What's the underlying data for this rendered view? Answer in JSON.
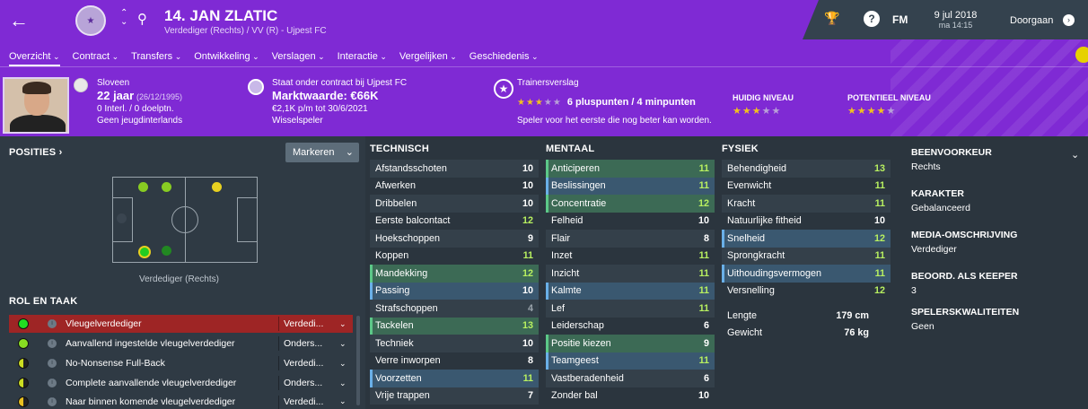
{
  "header": {
    "player_title": "14. JAN ZLATIC",
    "player_subtitle": "Verdediger (Rechts) / VV (R) - Ujpest FC",
    "fm_label": "FM",
    "date": "9 jul 2018",
    "time": "ma 14:15",
    "continue_label": "Doorgaan",
    "help_label": "?"
  },
  "nav": {
    "items": [
      {
        "label": "Overzicht"
      },
      {
        "label": "Contract"
      },
      {
        "label": "Transfers"
      },
      {
        "label": "Ontwikkeling"
      },
      {
        "label": "Verslagen"
      },
      {
        "label": "Interactie"
      },
      {
        "label": "Vergelijken"
      },
      {
        "label": "Geschiedenis"
      }
    ]
  },
  "profile": {
    "nationality": "Sloveen",
    "age": "22 jaar",
    "dob": "(26/12/1995)",
    "caps": "0 Interl. / 0 doelptn.",
    "youth": "Geen jeugdinterlands",
    "contract_text": "Staat onder contract bij Ujpest FC",
    "market_value": "Marktwaarde: €66K",
    "wage": "€2,1K p/m tot 30/6/2021",
    "squad_status": "Wisselspeler"
  },
  "trainer_report": {
    "title": "Trainersverslag",
    "stars_on": 3,
    "points": "6 pluspunten / 4 minpunten",
    "note": "Speler voor het eerste die nog beter kan worden.",
    "current_label": "HUIDIG NIVEAU",
    "current_stars": 3,
    "potential_label": "POTENTIEEL NIVEAU",
    "potential_stars": 4
  },
  "positions": {
    "title": "POSITIES ›",
    "mark_button": "Markeren",
    "position_label": "Verdediger (Rechts)"
  },
  "roles": {
    "title": "ROL EN TAAK",
    "items": [
      {
        "name": "Vleugelverdediger",
        "duty": "Verdedi...",
        "color": "#22dd22"
      },
      {
        "name": "Aanvallend ingestelde vleugelverdediger",
        "duty": "Onders...",
        "color": "#88dd22"
      },
      {
        "name": "No-Nonsense Full-Back",
        "duty": "Verdedi...",
        "color": "#ccdd22"
      },
      {
        "name": "Complete aanvallende vleugelverdediger",
        "duty": "Onders...",
        "color": "#ccdd22"
      },
      {
        "name": "Naar binnen komende vleugelverdediger",
        "duty": "Verdedi...",
        "color": "#e8c020"
      }
    ]
  },
  "technical": {
    "title": "TECHNISCH",
    "rows": [
      {
        "name": "Afstandsschoten",
        "value": "10"
      },
      {
        "name": "Afwerken",
        "value": "10"
      },
      {
        "name": "Dribbelen",
        "value": "10"
      },
      {
        "name": "Eerste balcontact",
        "value": "12"
      },
      {
        "name": "Hoekschoppen",
        "value": "9"
      },
      {
        "name": "Koppen",
        "value": "11"
      },
      {
        "name": "Mandekking",
        "value": "12"
      },
      {
        "name": "Passing",
        "value": "10"
      },
      {
        "name": "Strafschoppen",
        "value": "4"
      },
      {
        "name": "Tackelen",
        "value": "13"
      },
      {
        "name": "Techniek",
        "value": "10"
      },
      {
        "name": "Verre inworpen",
        "value": "8"
      },
      {
        "name": "Voorzetten",
        "value": "11"
      },
      {
        "name": "Vrije trappen",
        "value": "7"
      }
    ]
  },
  "mental": {
    "title": "MENTAAL",
    "rows": [
      {
        "name": "Anticiperen",
        "value": "11"
      },
      {
        "name": "Beslissingen",
        "value": "11"
      },
      {
        "name": "Concentratie",
        "value": "12"
      },
      {
        "name": "Felheid",
        "value": "10"
      },
      {
        "name": "Flair",
        "value": "8"
      },
      {
        "name": "Inzet",
        "value": "11"
      },
      {
        "name": "Inzicht",
        "value": "11"
      },
      {
        "name": "Kalmte",
        "value": "11"
      },
      {
        "name": "Lef",
        "value": "11"
      },
      {
        "name": "Leiderschap",
        "value": "6"
      },
      {
        "name": "Positie kiezen",
        "value": "9"
      },
      {
        "name": "Teamgeest",
        "value": "11"
      },
      {
        "name": "Vastberadenheid",
        "value": "6"
      },
      {
        "name": "Zonder bal",
        "value": "10"
      }
    ]
  },
  "physical": {
    "title": "FYSIEK",
    "rows": [
      {
        "name": "Behendigheid",
        "value": "13"
      },
      {
        "name": "Evenwicht",
        "value": "11"
      },
      {
        "name": "Kracht",
        "value": "11"
      },
      {
        "name": "Natuurlijke fitheid",
        "value": "10"
      },
      {
        "name": "Snelheid",
        "value": "12"
      },
      {
        "name": "Sprongkracht",
        "value": "11"
      },
      {
        "name": "Uithoudingsvermogen",
        "value": "11"
      },
      {
        "name": "Versnelling",
        "value": "12"
      }
    ],
    "length_label": "Lengte",
    "length_value": "179 cm",
    "weight_label": "Gewicht",
    "weight_value": "76 kg"
  },
  "details": {
    "foot_label": "BEENVOORKEUR",
    "foot_value": "Rechts",
    "character_label": "KARAKTER",
    "character_value": "Gebalanceerd",
    "media_label": "MEDIA-OMSCHRIJVING",
    "media_value": "Verdediger",
    "keeper_label": "BEOORD. ALS KEEPER",
    "keeper_value": "3",
    "qualities_label": "SPELERSKWALITEITEN",
    "qualities_value": "Geen"
  },
  "colors": {
    "header_purple": "#7f2ad4",
    "panel_dark": "#2f3a44",
    "selected_red": "#9e2525",
    "highlight_green": "#3c6a55",
    "highlight_blue": "#3a5870",
    "value_green": "#b8f060"
  }
}
